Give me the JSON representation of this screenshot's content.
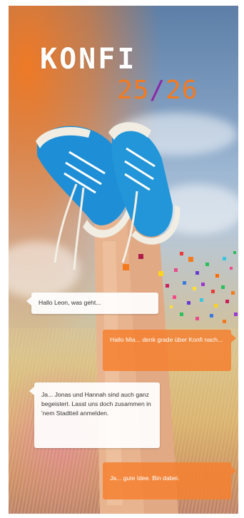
{
  "title": {
    "word": "KONFI",
    "year_start": "25",
    "slash": "/",
    "year_end": "26"
  },
  "chat": [
    {
      "side": "left",
      "style": "white",
      "text": "Hallo Leon, was geht..."
    },
    {
      "side": "right",
      "style": "orange",
      "text": "Hallo Mia... denk grade über Konfi nach..."
    },
    {
      "side": "left",
      "style": "white",
      "text": "Ja... Jonas und Hannah sind auch ganz begeistert. Lasst uns doch zusammen in 'nem Stadtteil anmelden."
    },
    {
      "side": "right",
      "style": "orange",
      "text": "Ja... gute Idee. Bin dabei."
    }
  ],
  "colors": {
    "accent_orange": "#f47a1f",
    "accent_purple": "#8a2aa8",
    "sneaker_blue": "#1e8fd6"
  }
}
